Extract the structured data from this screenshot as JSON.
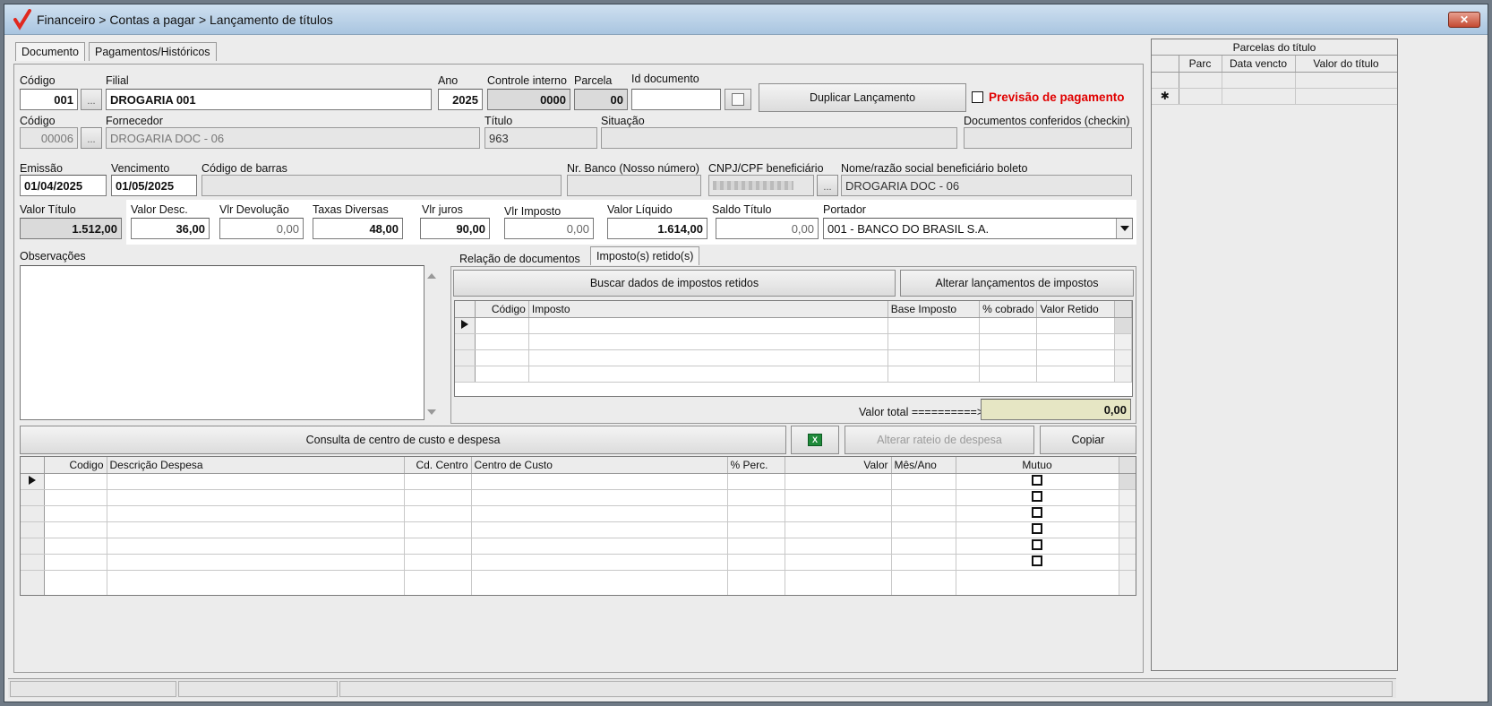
{
  "window": {
    "title": "Financeiro > Contas a pagar > Lançamento de títulos",
    "close_label": "✕"
  },
  "tabs": {
    "documento": "Documento",
    "pagamentos": "Pagamentos/Históricos"
  },
  "row1": {
    "codigo_label": "Código",
    "codigo_value": "001",
    "filial_label": "Filial",
    "filial_value": "DROGARIA 001",
    "ano_label": "Ano",
    "ano_value": "2025",
    "controle_label": "Controle interno",
    "controle_value": "0000",
    "parcela_label": "Parcela",
    "parcela_value": "00",
    "iddoc_label": "Id documento",
    "iddoc_value": "",
    "duplicar_label": "Duplicar Lançamento",
    "previsao_label": "Previsão de pagamento"
  },
  "row2": {
    "codigo_label": "Código",
    "codigo_value": "00006",
    "fornecedor_label": "Fornecedor",
    "fornecedor_value": "DROGARIA DOC - 06",
    "titulo_label": "Título",
    "titulo_value": "963",
    "situacao_label": "Situação",
    "situacao_value": "",
    "conferidos_label": "Documentos conferidos (checkin)",
    "conferidos_value": ""
  },
  "row3": {
    "emissao_label": "Emissão",
    "emissao_value": "01/04/2025",
    "vencimento_label": "Vencimento",
    "vencimento_value": "01/05/2025",
    "barras_label": "Código de barras",
    "barras_value": "",
    "nrbanco_label": "Nr. Banco (Nosso número)",
    "nrbanco_value": "",
    "cnpj_label": "CNPJ/CPF beneficiário",
    "nome_label": "Nome/razão social beneficiário boleto",
    "nome_value": "DROGARIA DOC - 06"
  },
  "row4": {
    "valor_titulo_label": "Valor Título",
    "valor_titulo_value": "1.512,00",
    "valor_desc_label": "Valor Desc.",
    "valor_desc_value": "36,00",
    "vlr_devolucao_label": "Vlr Devolução",
    "vlr_devolucao_value": "0,00",
    "taxas_label": "Taxas Diversas",
    "taxas_value": "48,00",
    "juros_label": "Vlr juros",
    "juros_value": "90,00",
    "imposto_label": "Vlr Imposto",
    "imposto_value": "0,00",
    "liquido_label": "Valor Líquido",
    "liquido_value": "1.614,00",
    "saldo_label": "Saldo Título",
    "saldo_value": "0,00",
    "portador_label": "Portador",
    "portador_value": "001 - BANCO DO BRASIL S.A."
  },
  "observacoes": {
    "label": "Observações",
    "value": ""
  },
  "subtabs": {
    "relacao": "Relação de documentos",
    "impostos": "Imposto(s) retido(s)"
  },
  "impostos": {
    "buscar_label": "Buscar dados de impostos retidos",
    "alterar_label": "Alterar lançamentos de impostos",
    "columns": [
      "Código",
      "Imposto",
      "Base Imposto",
      "% cobrado",
      "Valor Retido"
    ],
    "total_label": "Valor total ==========>",
    "total_value": "0,00"
  },
  "centro": {
    "consulta_label": "Consulta de centro de custo e despesa",
    "alterar_rateio_label": "Alterar rateio de despesa",
    "copiar_label": "Copiar",
    "columns": [
      "Codigo",
      "Descrição Despesa",
      "Cd. Centro",
      "Centro de Custo",
      "% Perc.",
      "Valor",
      "Mês/Ano",
      "Mutuo"
    ]
  },
  "parcelas": {
    "title": "Parcelas do título",
    "columns": [
      "Parc",
      "Data vencto",
      "Valor do título"
    ]
  },
  "colors": {
    "title_bar": "#b9d3ea",
    "window_bg": "#ececec",
    "previsao_red": "#e00000",
    "total_bg": "#e6e6c4"
  }
}
